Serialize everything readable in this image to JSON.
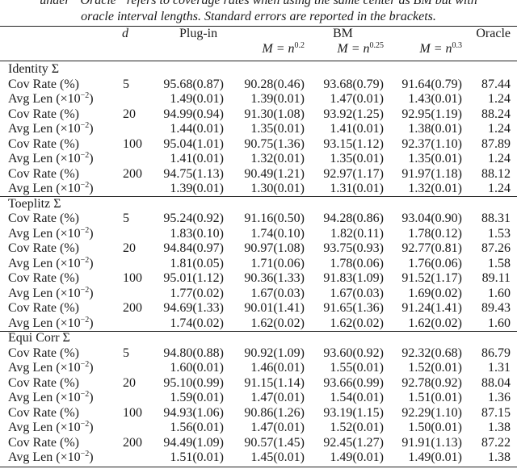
{
  "caption": {
    "line1": "under “Oracle” refers to coverage rates when using the same center as BM but with",
    "line2": "oracle interval lengths. Standard errors are reported in the brackets."
  },
  "header": {
    "d": "d",
    "plugin": "Plug-in",
    "bm": "BM",
    "oracle": "Oracle",
    "m_prefix": "M = n",
    "m_exps": [
      "0.2",
      "0.25",
      "0.3"
    ]
  },
  "row_labels": {
    "cov": "Cov Rate (%)",
    "len_prefix": "Avg Len (×10",
    "len_exp": "−2",
    "len_suffix": ")"
  },
  "sections": [
    {
      "title": "Identity Σ",
      "rows": [
        {
          "d": "5",
          "cov": [
            "95.68(0.87)",
            "90.28(0.46)",
            "93.68(0.79)",
            "91.64(0.79)",
            "87.44"
          ],
          "len": [
            "1.49(0.01)",
            "1.39(0.01)",
            "1.47(0.01)",
            "1.43(0.01)",
            "1.24"
          ]
        },
        {
          "d": "20",
          "cov": [
            "94.99(0.94)",
            "91.30(1.08)",
            "93.92(1.25)",
            "92.95(1.19)",
            "88.24"
          ],
          "len": [
            "1.44(0.01)",
            "1.35(0.01)",
            "1.41(0.01)",
            "1.38(0.01)",
            "1.24"
          ]
        },
        {
          "d": "100",
          "cov": [
            "95.04(1.01)",
            "90.75(1.36)",
            "93.15(1.12)",
            "92.37(1.10)",
            "87.89"
          ],
          "len": [
            "1.41(0.01)",
            "1.32(0.01)",
            "1.35(0.01)",
            "1.35(0.01)",
            "1.24"
          ]
        },
        {
          "d": "200",
          "cov": [
            "94.75(1.13)",
            "90.49(1.21)",
            "92.97(1.17)",
            "91.97(1.18)",
            "88.12"
          ],
          "len": [
            "1.39(0.01)",
            "1.30(0.01)",
            "1.31(0.01)",
            "1.32(0.01)",
            "1.24"
          ]
        }
      ]
    },
    {
      "title": "Toeplitz Σ",
      "rows": [
        {
          "d": "5",
          "cov": [
            "95.24(0.92)",
            "91.16(0.50)",
            "94.28(0.86)",
            "93.04(0.90)",
            "88.31"
          ],
          "len": [
            "1.83(0.10)",
            "1.74(0.10)",
            "1.82(0.11)",
            "1.78(0.12)",
            "1.53"
          ]
        },
        {
          "d": "20",
          "cov": [
            "94.84(0.97)",
            "90.97(1.08)",
            "93.75(0.93)",
            "92.77(0.81)",
            "87.26"
          ],
          "len": [
            "1.81(0.05)",
            "1.71(0.06)",
            "1.78(0.06)",
            "1.76(0.06)",
            "1.58"
          ]
        },
        {
          "d": "100",
          "cov": [
            "95.01(1.12)",
            "90.36(1.33)",
            "91.83(1.09)",
            "91.52(1.17)",
            "89.11"
          ],
          "len": [
            "1.77(0.02)",
            "1.67(0.03)",
            "1.67(0.03)",
            "1.69(0.02)",
            "1.60"
          ]
        },
        {
          "d": "200",
          "cov": [
            "94.69(1.33)",
            "90.01(1.41)",
            "91.65(1.36)",
            "91.24(1.41)",
            "89.43"
          ],
          "len": [
            "1.74(0.02)",
            "1.62(0.02)",
            "1.62(0.02)",
            "1.62(0.02)",
            "1.60"
          ]
        }
      ]
    },
    {
      "title": "Equi Corr Σ",
      "rows": [
        {
          "d": "5",
          "cov": [
            "94.80(0.88)",
            "90.92(1.09)",
            "93.60(0.92)",
            "92.32(0.68)",
            "86.79"
          ],
          "len": [
            "1.60(0.01)",
            "1.46(0.01)",
            "1.55(0.01)",
            "1.52(0.01)",
            "1.31"
          ]
        },
        {
          "d": "20",
          "cov": [
            "95.10(0.99)",
            "91.15(1.14)",
            "93.66(0.99)",
            "92.78(0.92)",
            "88.04"
          ],
          "len": [
            "1.59(0.01)",
            "1.47(0.01)",
            "1.54(0.01)",
            "1.51(0.01)",
            "1.36"
          ]
        },
        {
          "d": "100",
          "cov": [
            "94.93(1.06)",
            "90.86(1.26)",
            "93.19(1.15)",
            "92.29(1.10)",
            "87.15"
          ],
          "len": [
            "1.56(0.01)",
            "1.47(0.01)",
            "1.52(0.01)",
            "1.50(0.01)",
            "1.38"
          ]
        },
        {
          "d": "200",
          "cov": [
            "94.49(1.09)",
            "90.57(1.45)",
            "92.45(1.27)",
            "91.91(1.13)",
            "87.22"
          ],
          "len": [
            "1.51(0.01)",
            "1.45(0.01)",
            "1.49(0.01)",
            "1.49(0.01)",
            "1.38"
          ]
        }
      ]
    }
  ]
}
